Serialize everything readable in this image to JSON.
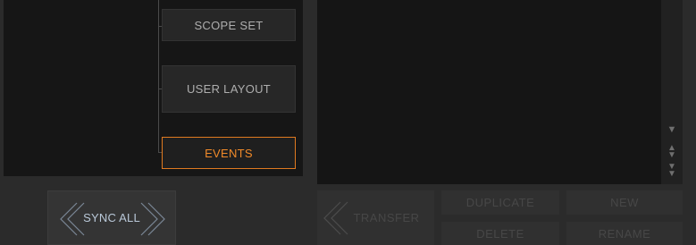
{
  "tree": {
    "items": [
      {
        "label": "SCOPE SET",
        "active": false
      },
      {
        "label": "USER LAYOUT",
        "active": false
      },
      {
        "label": "EVENTS",
        "active": true
      }
    ]
  },
  "sync": {
    "label": "SYNC ALL"
  },
  "actions": {
    "transfer": "TRANSFER",
    "duplicate": "DUPLICATE",
    "new": "NEW",
    "delete": "DELETE",
    "rename": "RENAME"
  },
  "colors": {
    "accent": "#f08a2a",
    "sync_text": "#b9c8d8"
  },
  "icons": {
    "scroll_down": "triangle-down-icon",
    "scroll_page": "double-arrow-updown-icon",
    "scroll_end": "double-arrow-down-icon"
  }
}
